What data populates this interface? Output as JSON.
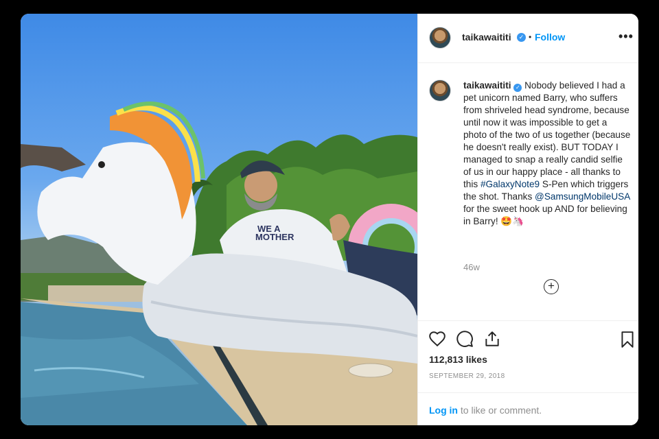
{
  "post": {
    "username": "taikawaititi",
    "verified_badge": "✓",
    "header_separator": "•",
    "follow_label": "Follow",
    "more_label": "•••",
    "caption_text": "Nobody believed I had a pet unicorn named Barry, who suffers from shriveled head syndrome, because until now it was impossible to get a photo of the two of us together (because he doesn't really exist). BUT TODAY I managed to snap a really candid selfie of us in our happy place - all thanks to this",
    "hashtag": "#GalaxyNote9",
    "caption_middle": "S-Pen which triggers the shot. Thanks",
    "mention": "@SamsungMobileUSA",
    "caption_end": "for the sweet hook up AND for believing in Barry!",
    "emojis": "🤩🦄",
    "time_ago": "46w",
    "load_more_label": "+",
    "likes": "112,813 likes",
    "date": "SEPTEMBER 29, 2018",
    "login_link": "Log in",
    "login_suffix": "to like or comment.",
    "shirt_text_line1": "WE A",
    "shirt_text_line2": "MOTHER"
  },
  "icons": {
    "avatar": "avatar-photo",
    "verified": "verified-badge-icon",
    "more": "more-options-icon",
    "load_more": "plus-circle-icon",
    "like": "heart-icon",
    "comment": "comment-icon",
    "share": "share-icon",
    "save": "bookmark-icon"
  },
  "colors": {
    "accent": "#0095f6",
    "verified": "#3897f0",
    "text": "#262626",
    "muted": "#8e8e8e",
    "background": "#000000"
  }
}
